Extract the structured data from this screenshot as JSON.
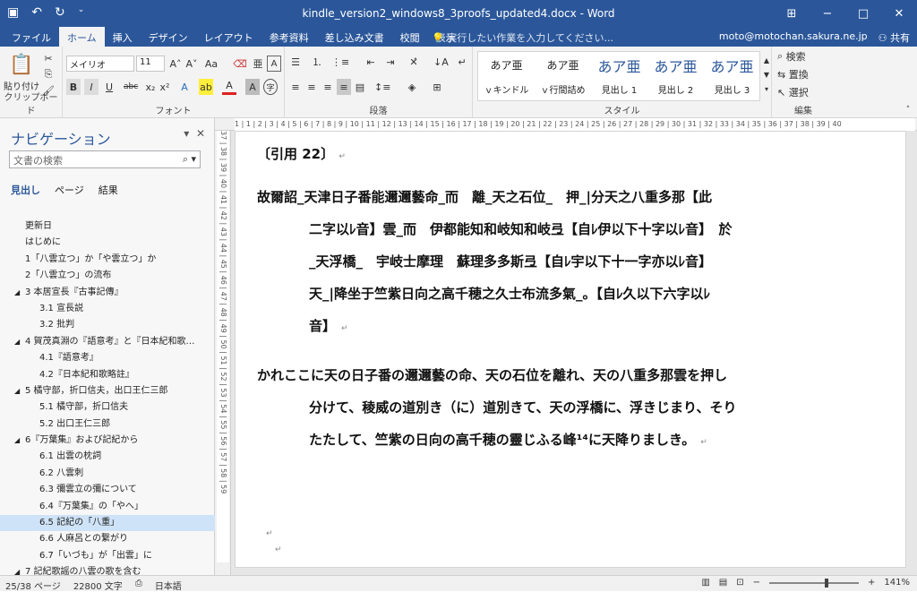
{
  "titlebar": {
    "title": "kindle_version2_windows8_3proofs_updated4.docx - Word",
    "save_icon": "save-icon",
    "undo_icon": "undo-icon",
    "redo_icon": "redo-icon",
    "qa_icon": "customize-icon",
    "restore_icon": "ribbon-display-icon",
    "min": "−",
    "max": "□",
    "close": "✕"
  },
  "tabs": [
    {
      "label": "ファイル",
      "active": false
    },
    {
      "label": "ホーム",
      "active": true
    },
    {
      "label": "挿入",
      "active": false
    },
    {
      "label": "デザイン",
      "active": false
    },
    {
      "label": "レイアウト",
      "active": false
    },
    {
      "label": "参考資料",
      "active": false
    },
    {
      "label": "差し込み文書",
      "active": false
    },
    {
      "label": "校閲",
      "active": false
    },
    {
      "label": "表示",
      "active": false
    }
  ],
  "tell_me": "実行したい作業を入力してください...",
  "account": {
    "email": "moto@motochan.sakura.ne.jp",
    "share": "共有"
  },
  "ribbon": {
    "clipboard": {
      "paste": "貼り付け",
      "label": "クリップボード"
    },
    "font": {
      "name": "メイリオ",
      "size": "11",
      "aa": "Aa",
      "label": "フォント"
    },
    "paragraph": {
      "label": "段落"
    },
    "styles": {
      "label": "スタイル",
      "items": [
        {
          "preview": "あア亜",
          "name": "ｖキンドル"
        },
        {
          "preview": "あア亜",
          "name": "ｖ行間詰め"
        },
        {
          "preview": "あア亜",
          "name": "見出し 1"
        },
        {
          "preview": "あア亜",
          "name": "見出し 2"
        },
        {
          "preview": "あア亜",
          "name": "見出し 3"
        }
      ]
    },
    "editing": {
      "find": "検索",
      "replace": "置換",
      "select": "選択",
      "label": "編集"
    }
  },
  "nav": {
    "title": "ナビゲーション",
    "search_placeholder": "文書の検索",
    "tabs": [
      "見出し",
      "ページ",
      "結果"
    ],
    "items": [
      {
        "text": "更新日",
        "level": 1,
        "expand": ""
      },
      {
        "text": "はじめに",
        "level": 1,
        "expand": ""
      },
      {
        "text": "1「八雲立つ」か「や雲立つ」か",
        "level": 1,
        "expand": ""
      },
      {
        "text": "2「八雲立つ」の流布",
        "level": 1,
        "expand": ""
      },
      {
        "text": "3 本居宣長『古事記傳』",
        "level": 1,
        "expand": "◢"
      },
      {
        "text": "3.1 宣長説",
        "level": 2,
        "expand": ""
      },
      {
        "text": "3.2 批判",
        "level": 2,
        "expand": ""
      },
      {
        "text": "4 賀茂真淵の『語意考』と『日本紀和歌…",
        "level": 1,
        "expand": "◢"
      },
      {
        "text": "4.1『語意考』",
        "level": 2,
        "expand": ""
      },
      {
        "text": "4.2『日本紀和歌略註』",
        "level": 2,
        "expand": ""
      },
      {
        "text": "5 橘守部，折口信夫，出口王仁三郎",
        "level": 1,
        "expand": "◢"
      },
      {
        "text": "5.1 橘守部，折口信夫",
        "level": 2,
        "expand": ""
      },
      {
        "text": "5.2 出口王仁三郎",
        "level": 2,
        "expand": ""
      },
      {
        "text": "6『万葉集』および記紀から",
        "level": 1,
        "expand": "◢"
      },
      {
        "text": "6.1 出雲の枕詞",
        "level": 2,
        "expand": ""
      },
      {
        "text": "6.2 八雲刺",
        "level": 2,
        "expand": ""
      },
      {
        "text": "6.3 彌雲立の彌について",
        "level": 2,
        "expand": ""
      },
      {
        "text": "6.4『万葉集』の「やへ」",
        "level": 2,
        "expand": ""
      },
      {
        "text": "6.5 記紀の「八重」",
        "level": 2,
        "expand": "",
        "selected": true
      },
      {
        "text": "6.6 人麻呂との繋がり",
        "level": 2,
        "expand": ""
      },
      {
        "text": "6.7「いづも」が「出雲」に",
        "level": 2,
        "expand": ""
      },
      {
        "text": "7 記紀歌謡の八雲の歌を含む",
        "level": 1,
        "expand": "◢"
      }
    ]
  },
  "ruler": "1 | 1 | 2 | 3 | 4 | 5 | 6 | 7 | 8 | 9 | 10 | 11 | 12 | 13 | 14 | 15 | 16 | 17 | 18 | 19 | 20 | 21 | 22 | 23 | 24 | 25 | 26 | 27 | 28 | 29 | 30 | 31 | 32 | 33 | 34 | 35 | 36 | 37 | 38 | 39 | 40",
  "vruler": "37 | 38 | 39 | 40 | 41 | 42 | 43 | 44 | 45 | 46 | 47 | 48 | 49 | 50 | 51 | 52 | 53 | 54 | 55 | 56 | 57 | 58 | 59",
  "doc": {
    "heading": "〔引用 22〕",
    "p1": [
      "故爾詔_天津日子番能邇邇藝命_而　離_天之石位_　押_|分天之八重多那【此",
      "二字以ﾚ音】雲_而　伊都能知和岐知和岐弖【自ﾚ伊以下十字以ﾚ音】　於",
      "_天浮橋_　宇岐士摩理　蘇理多多斯弖【自ﾚ宇以下十一字亦以ﾚ音】",
      "天_|降坐于竺紫日向之高千穂之久士布流多氣_。【自ﾚ久以下六字以ﾚ",
      "音】"
    ],
    "p2": [
      "かれここに天の日子番の邇邇藝の命、天の石位を離れ、天の八重多那雲を押し",
      "分けて、稜威の道別き（に）道別きて、天の浮橋に、浮きじまり、そり",
      "たたして、竺紫の日向の高千穂の靈じふる峰¹⁴に天降りましき。"
    ],
    "pilcrow": "↵"
  },
  "status": {
    "page": "25/38 ページ",
    "words": "22800 文字",
    "lang": "日本語",
    "zoom": "141%",
    "zoom_minus": "−",
    "zoom_plus": "+"
  }
}
